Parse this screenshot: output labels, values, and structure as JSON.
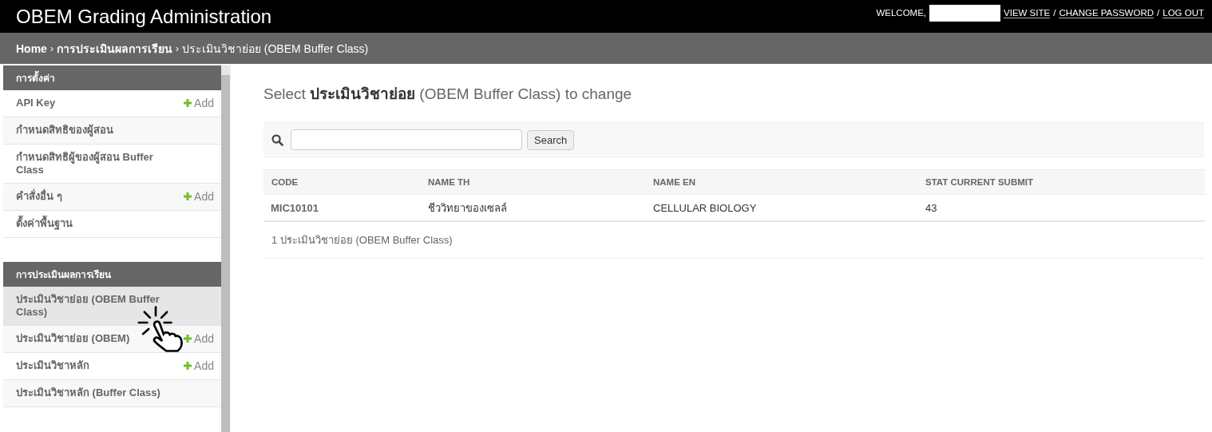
{
  "header": {
    "title": "OBEM Grading Administration",
    "welcome": "WELCOME,",
    "links": [
      "VIEW SITE",
      "CHANGE PASSWORD",
      "LOG OUT"
    ],
    "separator": "/"
  },
  "breadcrumbs": {
    "items": [
      {
        "label": "Home",
        "bold": true
      },
      {
        "label": "การประเมินผลการเรียน",
        "bold": true
      },
      {
        "label": "ประเมินวิชาย่อย (OBEM Buffer Class)",
        "bold": false
      }
    ],
    "separator": "›"
  },
  "sidebar": {
    "sections": [
      {
        "title": "การตั้งค่า",
        "items": [
          {
            "label": "API Key",
            "add": "Add",
            "selected": false
          },
          {
            "label": "กำหนดสิทธิของผู้สอน",
            "selected": false
          },
          {
            "label": "กำหนดสิทธิผู้ของผู้สอน Buffer Class",
            "selected": false
          },
          {
            "label": "คำสั่งอื่น ๆ",
            "add": "Add",
            "selected": false
          },
          {
            "label": "ตั้งค่าพื้นฐาน",
            "selected": false
          }
        ]
      },
      {
        "title": "การประเมินผลการเรียน",
        "items": [
          {
            "label": "ประเมินวิชาย่อย (OBEM Buffer Class)",
            "selected": true
          },
          {
            "label": "ประเมินวิชาย่อย (OBEM)",
            "add": "Add",
            "selected": false
          },
          {
            "label": "ประเมินวิชาหลัก",
            "add": "Add",
            "selected": false
          },
          {
            "label": "ประเมินวิชาหลัก (Buffer Class)",
            "selected": false
          }
        ]
      }
    ]
  },
  "main": {
    "heading": "Select **ประเมินวิชาย่อย** (OBEM Buffer Class) to change",
    "search_button": "Search",
    "table": {
      "columns": [
        "CODE",
        "NAME TH",
        "NAME EN",
        "STAT CURRENT SUBMIT"
      ],
      "rows": [
        [
          "MIC10101",
          "ชีววิทยาของเซลล์",
          "CELLULAR BIOLOGY",
          "43"
        ]
      ]
    },
    "result_count": "1 ประเมินวิชาย่อย (OBEM Buffer Class)"
  }
}
